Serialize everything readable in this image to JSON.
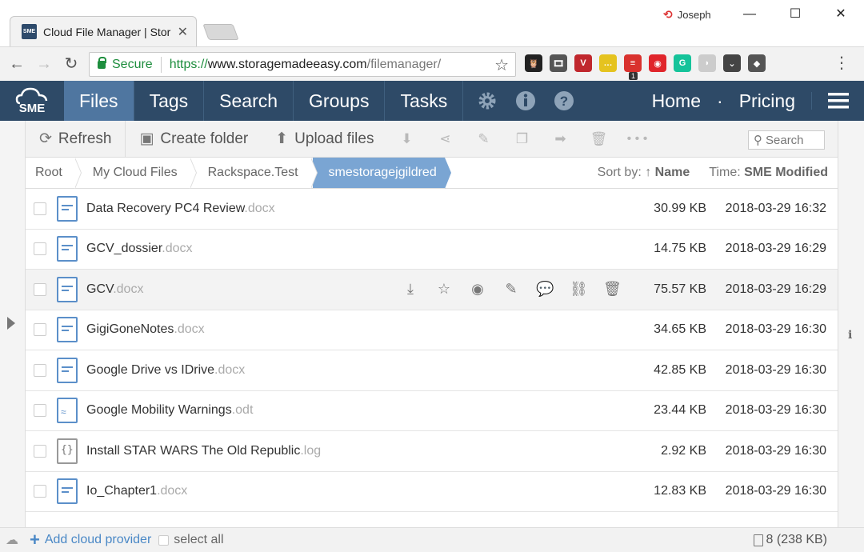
{
  "browser": {
    "tab_title": "Cloud File Manager | Stor",
    "tab_favicon": "SME",
    "profile_name": "Joseph",
    "url_secure_label": "Secure",
    "url_scheme": "https://",
    "url_host": "www.storagemadeeasy.com",
    "url_path": "/filemanager/",
    "extensions": [
      {
        "name": "owl-icon",
        "color": "#222222",
        "glyph": "🦉"
      },
      {
        "name": "film-icon",
        "color": "#555555",
        "glyph": "🎞"
      },
      {
        "name": "vivaldi-icon",
        "color": "#c0272d",
        "glyph": "V"
      },
      {
        "name": "chat-icon",
        "color": "#e5c31f",
        "glyph": "…"
      },
      {
        "name": "todo-icon",
        "color": "#d9322e",
        "glyph": "≡"
      },
      {
        "name": "ghost-icon",
        "color": "#e0252b",
        "glyph": "◉"
      },
      {
        "name": "grammarly-icon",
        "color": "#15c39a",
        "glyph": "G"
      },
      {
        "name": "flag-icon",
        "color": "#cccccc",
        "glyph": "◗"
      },
      {
        "name": "pocket-icon",
        "color": "#444444",
        "glyph": "⌄"
      },
      {
        "name": "puzzle-icon",
        "color": "#555555",
        "glyph": "◆"
      }
    ],
    "ext_badge": "1"
  },
  "nav": {
    "logo_text": "SME",
    "items": [
      "Files",
      "Tags",
      "Search",
      "Groups",
      "Tasks"
    ],
    "right_links": [
      "Home",
      "·",
      "Pricing"
    ]
  },
  "toolbar": {
    "refresh": "Refresh",
    "create_folder": "Create folder",
    "upload_files": "Upload files",
    "search_placeholder": "Search"
  },
  "breadcrumb": [
    "Root",
    "My Cloud Files",
    "Rackspace.Test",
    "smestoragejgildred"
  ],
  "sort": {
    "sort_label": "Sort by: ↑",
    "sort_value": "Name",
    "time_label": "Time:",
    "time_value": "SME Modified"
  },
  "files": [
    {
      "name": "Data Recovery PC4 Review",
      "ext": ".docx",
      "size": "30.99 KB",
      "date": "2018-03-29 16:32",
      "type": "doc"
    },
    {
      "name": "GCV_dossier",
      "ext": ".docx",
      "size": "14.75 KB",
      "date": "2018-03-29 16:29",
      "type": "doc"
    },
    {
      "name": "GCV",
      "ext": ".docx",
      "size": "75.57 KB",
      "date": "2018-03-29 16:29",
      "type": "doc"
    },
    {
      "name": "GigiGoneNotes",
      "ext": ".docx",
      "size": "34.65 KB",
      "date": "2018-03-29 16:30",
      "type": "doc"
    },
    {
      "name": "Google Drive vs IDrive",
      "ext": ".docx",
      "size": "42.85 KB",
      "date": "2018-03-29 16:30",
      "type": "doc"
    },
    {
      "name": "Google Mobility Warnings",
      "ext": ".odt",
      "size": "23.44 KB",
      "date": "2018-03-29 16:30",
      "type": "odt"
    },
    {
      "name": "Install STAR WARS The Old Republic",
      "ext": ".log",
      "size": "2.92 KB",
      "date": "2018-03-29 16:30",
      "type": "log"
    },
    {
      "name": "Io_Chapter1",
      "ext": ".docx",
      "size": "12.83 KB",
      "date": "2018-03-29 16:30",
      "type": "doc"
    }
  ],
  "footer": {
    "add_provider": "Add cloud provider",
    "select_all": "select all",
    "summary": "8 (238 KB)"
  }
}
